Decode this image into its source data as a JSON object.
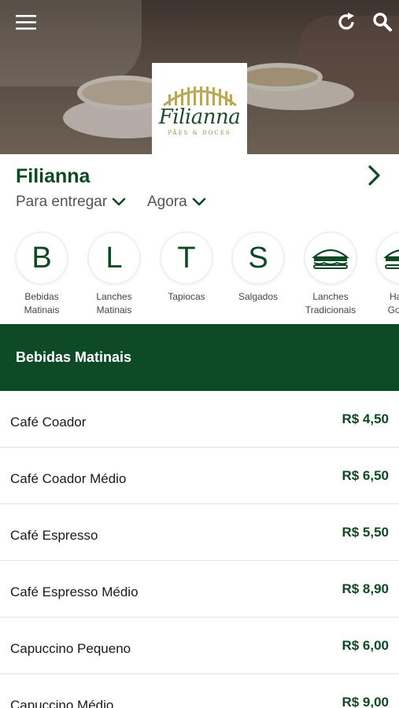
{
  "hero": {
    "logo_script": "Filianna",
    "logo_sub": "PÃES & DOCES"
  },
  "icons": {
    "menu": "menu-icon",
    "refresh": "refresh-icon",
    "search": "search-icon",
    "chevron_right": "chevron-right-icon",
    "chevron_down": "chevron-down-icon",
    "sandwich": "sandwich-icon"
  },
  "store": {
    "name": "Filianna",
    "delivery_mode": "Para entregar",
    "time": "Agora"
  },
  "categories": [
    {
      "glyph": "B",
      "label_line1": "Bebidas",
      "label_line2": "Matinais"
    },
    {
      "glyph": "L",
      "label_line1": "Lanches",
      "label_line2": "Matinais"
    },
    {
      "glyph": "T",
      "label_line1": "Tapiocas",
      "label_line2": ""
    },
    {
      "glyph": "S",
      "label_line1": "Salgados",
      "label_line2": ""
    },
    {
      "glyph": "",
      "label_line1": "Lanches",
      "label_line2": "Tradicionais"
    },
    {
      "glyph": "",
      "label_line1": "Hamb",
      "label_line2": "Gourm"
    }
  ],
  "section": {
    "title": "Bebidas Matinais"
  },
  "items": [
    {
      "name": "Café Coador",
      "price": "R$ 4,50"
    },
    {
      "name": "Café Coador Médio",
      "price": "R$ 6,50"
    },
    {
      "name": "Café Espresso",
      "price": "R$ 5,50"
    },
    {
      "name": "Café Espresso Médio",
      "price": "R$ 8,90"
    },
    {
      "name": "Capuccino Pequeno",
      "price": "R$ 6,00"
    },
    {
      "name": "Capuccino Médio",
      "price": "R$ 9,00"
    }
  ],
  "colors": {
    "brand_green": "#0f4a26",
    "text_green": "#0d4a24",
    "logo_gold": "#9b8a44"
  }
}
